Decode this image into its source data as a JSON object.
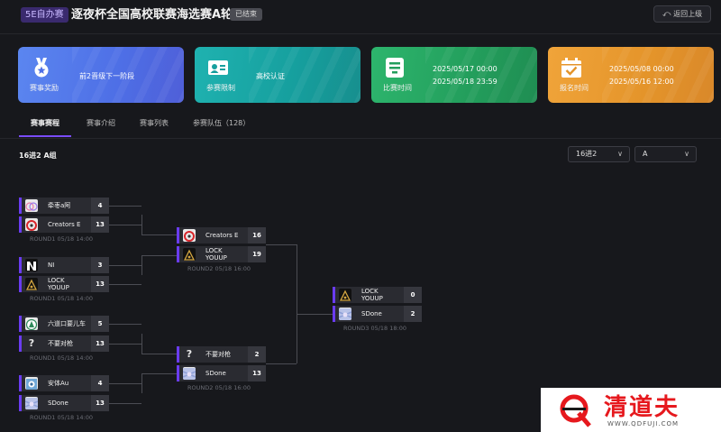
{
  "header": {
    "badge": "5E自办赛",
    "title": "逐夜杯全国高校联赛海选赛A轮",
    "status": "已结束",
    "back_label": "返回上级"
  },
  "cards": [
    {
      "label": "赛事奖励",
      "value": "前2晋级下一阶段",
      "icon": "medal-icon",
      "color": "#4e6fe6"
    },
    {
      "label": "参赛限制",
      "value": "高校认证",
      "icon": "id-card-icon",
      "color": "#169f9e"
    },
    {
      "label": "比赛时间",
      "start": "2025/05/17 00:00",
      "end": "2025/05/18 23:59",
      "icon": "document-icon",
      "color": "#239e5c"
    },
    {
      "label": "报名时间",
      "start": "2025/05/08 00:00",
      "end": "2025/05/16 12:00",
      "icon": "calendar-check-icon",
      "color": "#e4942a"
    }
  ],
  "tabs": [
    "赛事赛程",
    "赛事介绍",
    "赛事列表",
    "参赛队伍（128）"
  ],
  "group_title": "16进2 A组",
  "filters": {
    "stage": "16进2",
    "group": "A"
  },
  "bracket": {
    "round1": [
      {
        "teams": [
          {
            "name": "牵枣a阿",
            "score": "4"
          },
          {
            "name": "Creators E",
            "score": "13"
          }
        ],
        "label": "ROUND1 05/18 14:00"
      },
      {
        "teams": [
          {
            "name": "NI",
            "score": "3"
          },
          {
            "name": "LOCK YOUUP",
            "score": "13"
          }
        ],
        "label": "ROUND1 05/18 14:00"
      },
      {
        "teams": [
          {
            "name": "六道口要儿车",
            "score": "5"
          },
          {
            "name": "不要对枪",
            "score": "13"
          }
        ],
        "label": "ROUND1 05/18 14:00"
      },
      {
        "teams": [
          {
            "name": "安体Au",
            "score": "4"
          },
          {
            "name": "SDone",
            "score": "13"
          }
        ],
        "label": "ROUND1 05/18 14:00"
      }
    ],
    "round2": [
      {
        "teams": [
          {
            "name": "Creators E",
            "score": "16"
          },
          {
            "name": "LOCK YOUUP",
            "score": "19"
          }
        ],
        "label": "ROUND2 05/18 16:00"
      },
      {
        "teams": [
          {
            "name": "不要对枪",
            "score": "2"
          },
          {
            "name": "SDone",
            "score": "13"
          }
        ],
        "label": "ROUND2 05/18 16:00"
      }
    ],
    "round3": [
      {
        "teams": [
          {
            "name": "LOCK YOUUP",
            "score": "0"
          },
          {
            "name": "SDone",
            "score": "2"
          }
        ],
        "label": "ROUND3 05/18 18:00"
      }
    ]
  },
  "watermark": {
    "brand": "清道夫",
    "url": "WWW.QDFUJI.COM"
  },
  "colors": {
    "accent": "#6a3cf0",
    "watermark_red": "#e6181d"
  }
}
